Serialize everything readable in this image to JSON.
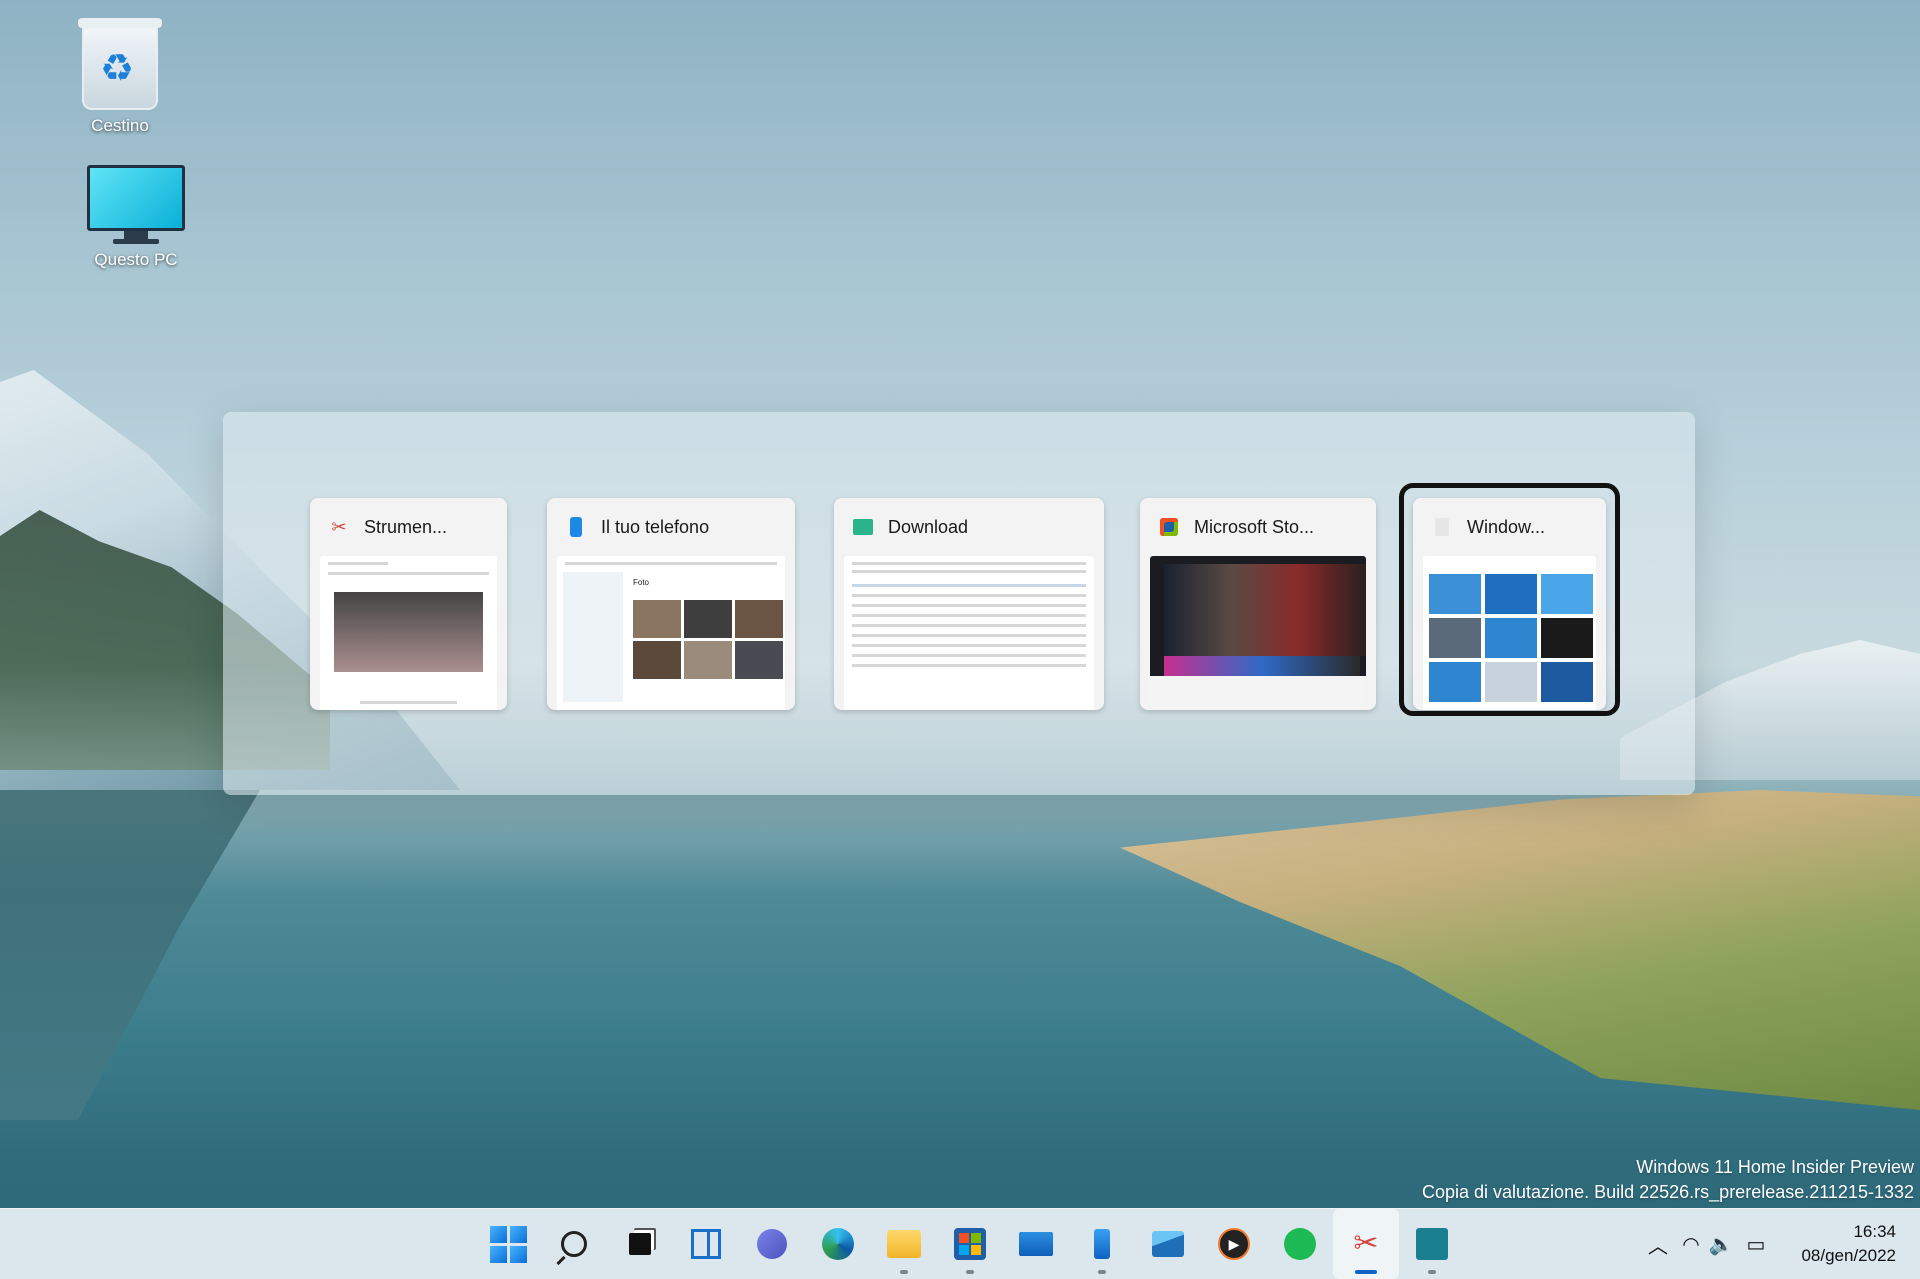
{
  "desktop": {
    "icons": [
      {
        "label": "Cestino",
        "icon": "recycle-bin-icon"
      },
      {
        "label": "Questo PC",
        "icon": "this-pc-icon"
      }
    ]
  },
  "switcher": {
    "windows": [
      {
        "title": "Strumen...",
        "icon": "snipping-tool-icon"
      },
      {
        "title": "Il tuo telefono",
        "icon": "your-phone-icon"
      },
      {
        "title": "Download",
        "icon": "folder-download-icon"
      },
      {
        "title": "Microsoft Sto...",
        "icon": "microsoft-store-icon"
      },
      {
        "title": "Window...",
        "icon": "windows-app-icon"
      }
    ],
    "selected_index": 4,
    "thumb_text": {
      "photos_label": "Foto"
    }
  },
  "watermark": {
    "line1": "Windows 11 Home Insider Preview",
    "line2": "Copia di valutazione. Build 22526.rs_prerelease.211215-1332"
  },
  "taskbar": {
    "apps": [
      {
        "name": "start",
        "icon": "windows-start-icon"
      },
      {
        "name": "search",
        "icon": "search-icon"
      },
      {
        "name": "task-view",
        "icon": "task-view-icon"
      },
      {
        "name": "widgets",
        "icon": "widgets-icon"
      },
      {
        "name": "chat",
        "icon": "teams-chat-icon"
      },
      {
        "name": "edge",
        "icon": "edge-icon"
      },
      {
        "name": "file-explorer",
        "icon": "file-explorer-icon"
      },
      {
        "name": "store",
        "icon": "microsoft-store-icon"
      },
      {
        "name": "mail",
        "icon": "mail-icon"
      },
      {
        "name": "your-phone",
        "icon": "your-phone-icon"
      },
      {
        "name": "photos",
        "icon": "photos-icon"
      },
      {
        "name": "media-player",
        "icon": "media-player-icon"
      },
      {
        "name": "spotify",
        "icon": "spotify-icon"
      },
      {
        "name": "snipping-tool",
        "icon": "snipping-tool-icon"
      },
      {
        "name": "windows-app",
        "icon": "windows-app-icon"
      }
    ],
    "tray": {
      "time": "16:34",
      "date": "08/gen/2022"
    }
  },
  "colors": {
    "accent": "#0a64c8",
    "selection_border": "#111111"
  }
}
